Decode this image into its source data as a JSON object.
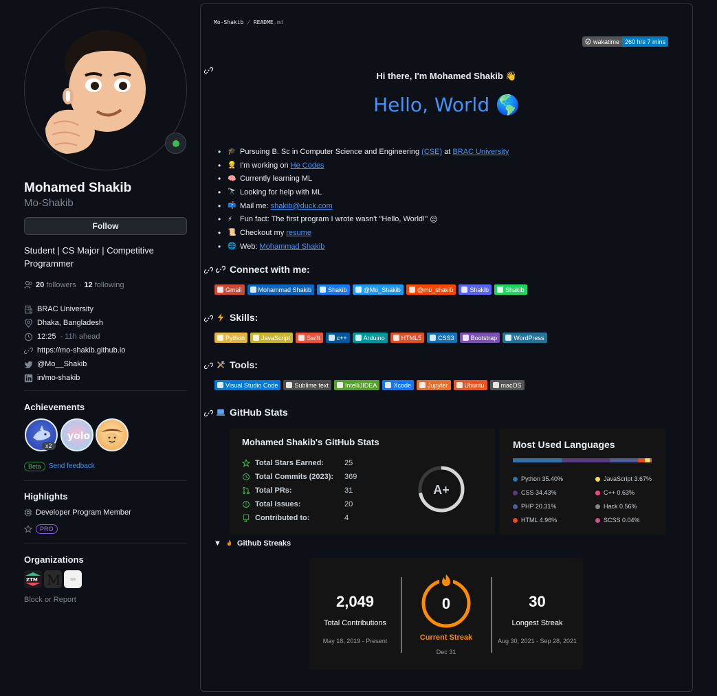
{
  "profile": {
    "name": "Mohamed Shakib",
    "login": "Mo-Shakib",
    "follow_label": "Follow",
    "bio": "Student | CS Major | Competitive Programmer",
    "followers_count": "20",
    "followers_label": "followers",
    "following_count": "12",
    "following_label": "following",
    "separator": "·",
    "company": "BRAC University",
    "location": "Dhaka, Bangladesh",
    "local_time": "12:25",
    "time_ahead": "- 11h ahead",
    "website": "https://mo-shakib.github.io",
    "twitter": "@Mo__Shakib",
    "linkedin": "in/mo-shakib"
  },
  "achievements": {
    "title": "Achievements",
    "multiplier": "x2",
    "beta": "Beta",
    "feedback": "Send feedback"
  },
  "highlights": {
    "title": "Highlights",
    "item1": "Developer Program Member",
    "pro": "PRO"
  },
  "organizations": {
    "title": "Organizations",
    "block": "Block or Report"
  },
  "readme": {
    "owner": "Mo-Shakib",
    "slash": "/",
    "file": "README",
    "ext": ".md",
    "waka_label": "wakatime",
    "waka_value": "260 hrs 7 mins",
    "greeting": "Hi there, I'm Mohamed Shakib",
    "greeting_emoji": "👋",
    "hello": "Hello, World",
    "hello_emoji": "🌎",
    "bullets": {
      "b1_pre": "Pursuing B. Sc in Computer Science and Engineering",
      "b1_link1": "(CSE)",
      "b1_mid": "at",
      "b1_link2": "BRAC University",
      "b2_pre": "I'm working on",
      "b2_link": "He Codes",
      "b3": "Currently learning ML",
      "b4": "Looking for help with ML",
      "b5_pre": "Mail me:",
      "b5_link": "shakib@duck.com",
      "b6": "Fun fact: The first program I wrote wasn't \"Hello, World!\"",
      "b6_emoji": "😔",
      "b7_pre": "Checkout my",
      "b7_link": "resume",
      "b8_pre": "Web:",
      "b8_link": "Mohammad Shakib"
    },
    "connect_title": "Connect with me:",
    "connect_badges": [
      "Gmail",
      "Mohammad Shakib",
      "Shakib",
      "@Mo_Shakib",
      "@mo_shakib",
      "Shakib",
      "Shakib"
    ],
    "connect_colors": [
      "#d14836",
      "#0a66c2",
      "#1877f2",
      "#1d9bf0",
      "#ff4500",
      "#5865f2",
      "#1ed760"
    ],
    "skills_title": "Skills:",
    "skills_badges": [
      "Python",
      "JavaScript",
      "Swift",
      "c++",
      "Arduino",
      "HTML5",
      "CSS3",
      "Bootstrap",
      "WordPress"
    ],
    "skills_colors": [
      "#e3b53d",
      "#c9b52e",
      "#f05138",
      "#00599c",
      "#00979d",
      "#e34f26",
      "#1572b6",
      "#7952b3",
      "#21759b"
    ],
    "tools_title": "Tools:",
    "tools_badges": [
      "Visual Studio Code",
      "Sublime text",
      "IntelliJIDEA",
      "Xcode",
      "Jupyter",
      "Ubuntu",
      "macOS"
    ],
    "tools_colors": [
      "#0078d7",
      "#4c4c4c",
      "#55a02a",
      "#1575f9",
      "#e46e2e",
      "#e95420",
      "#555555"
    ],
    "stats_title": "GitHub Stats"
  },
  "stats_card": {
    "title": "Mohamed Shakib's GitHub Stats",
    "rows": [
      {
        "label": "Total Stars Earned:",
        "value": "25"
      },
      {
        "label": "Total Commits (2023):",
        "value": "369"
      },
      {
        "label": "Total PRs:",
        "value": "31"
      },
      {
        "label": "Total Issues:",
        "value": "20"
      },
      {
        "label": "Contributed to:",
        "value": "4"
      }
    ],
    "rank": "A+",
    "rank_progress": 0.72,
    "colors": {
      "icon": "#3fb950",
      "ring": "#d6d6d6"
    }
  },
  "languages_card": {
    "title": "Most Used Languages",
    "items": [
      {
        "name": "Python 35.40%",
        "pct": 35.4,
        "color": "#3572a5"
      },
      {
        "name": "CSS 34.43%",
        "pct": 34.43,
        "color": "#563d7c"
      },
      {
        "name": "PHP 20.31%",
        "pct": 20.31,
        "color": "#4f5d95"
      },
      {
        "name": "HTML 4.96%",
        "pct": 4.96,
        "color": "#e34c26"
      },
      {
        "name": "JavaScript 3.67%",
        "pct": 3.67,
        "color": "#f1e05a"
      },
      {
        "name": "C++ 0.63%",
        "pct": 0.63,
        "color": "#f34b7d"
      },
      {
        "name": "Hack 0.56%",
        "pct": 0.56,
        "color": "#878787"
      },
      {
        "name": "SCSS 0.04%",
        "pct": 0.04,
        "color": "#c6538c"
      }
    ]
  },
  "streaks": {
    "summary": "Github Streaks",
    "total": "2,049",
    "total_label": "Total Contributions",
    "total_range": "May 18, 2019 - Present",
    "current": "0",
    "current_label": "Current Streak",
    "current_date": "Dec 31",
    "longest": "30",
    "longest_label": "Longest Streak",
    "longest_range": "Aug 30, 2021 - Sep 28, 2021",
    "colors": {
      "accent": "#fb8c00"
    }
  }
}
